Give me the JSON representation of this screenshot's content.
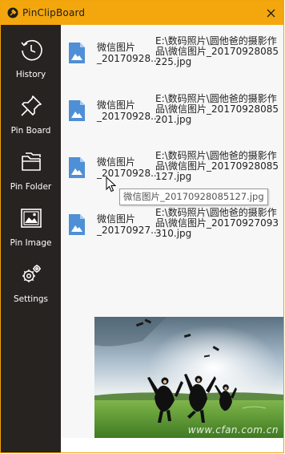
{
  "window": {
    "title": "PinClipBoard",
    "accent": "#f3a70d"
  },
  "sidebar": {
    "items": [
      {
        "label": "History",
        "icon": "clock-icon"
      },
      {
        "label": "Pin Board",
        "icon": "pushpin-icon"
      },
      {
        "label": "Pin Folder",
        "icon": "folder-icon"
      },
      {
        "label": "Pin Image",
        "icon": "picture-icon"
      },
      {
        "label": "Settings",
        "icon": "gears-icon"
      }
    ]
  },
  "list": {
    "items": [
      {
        "name": "微信图片\n_20170928...",
        "path": "E:\\数码照片\\圆他爸的摄影作品\\微信图片_20170928085225.jpg"
      },
      {
        "name": "微信图片\n_20170928...",
        "path": "E:\\数码照片\\圆他爸的摄影作品\\微信图片_20170928085201.jpg"
      },
      {
        "name": "微信图片\n_20170928...",
        "path": "E:\\数码照片\\圆他爸的摄影作品\\微信图片_20170928085127.jpg"
      },
      {
        "name": "微信图片\n_20170927...",
        "path": "E:\\数码照片\\圆他爸的摄影作品\\微信图片_20170927093310.jpg"
      }
    ]
  },
  "tooltip": {
    "text": "微信图片_20170928085127.jpg"
  },
  "preview": {
    "watermark": "www.cfan.com.cn"
  }
}
